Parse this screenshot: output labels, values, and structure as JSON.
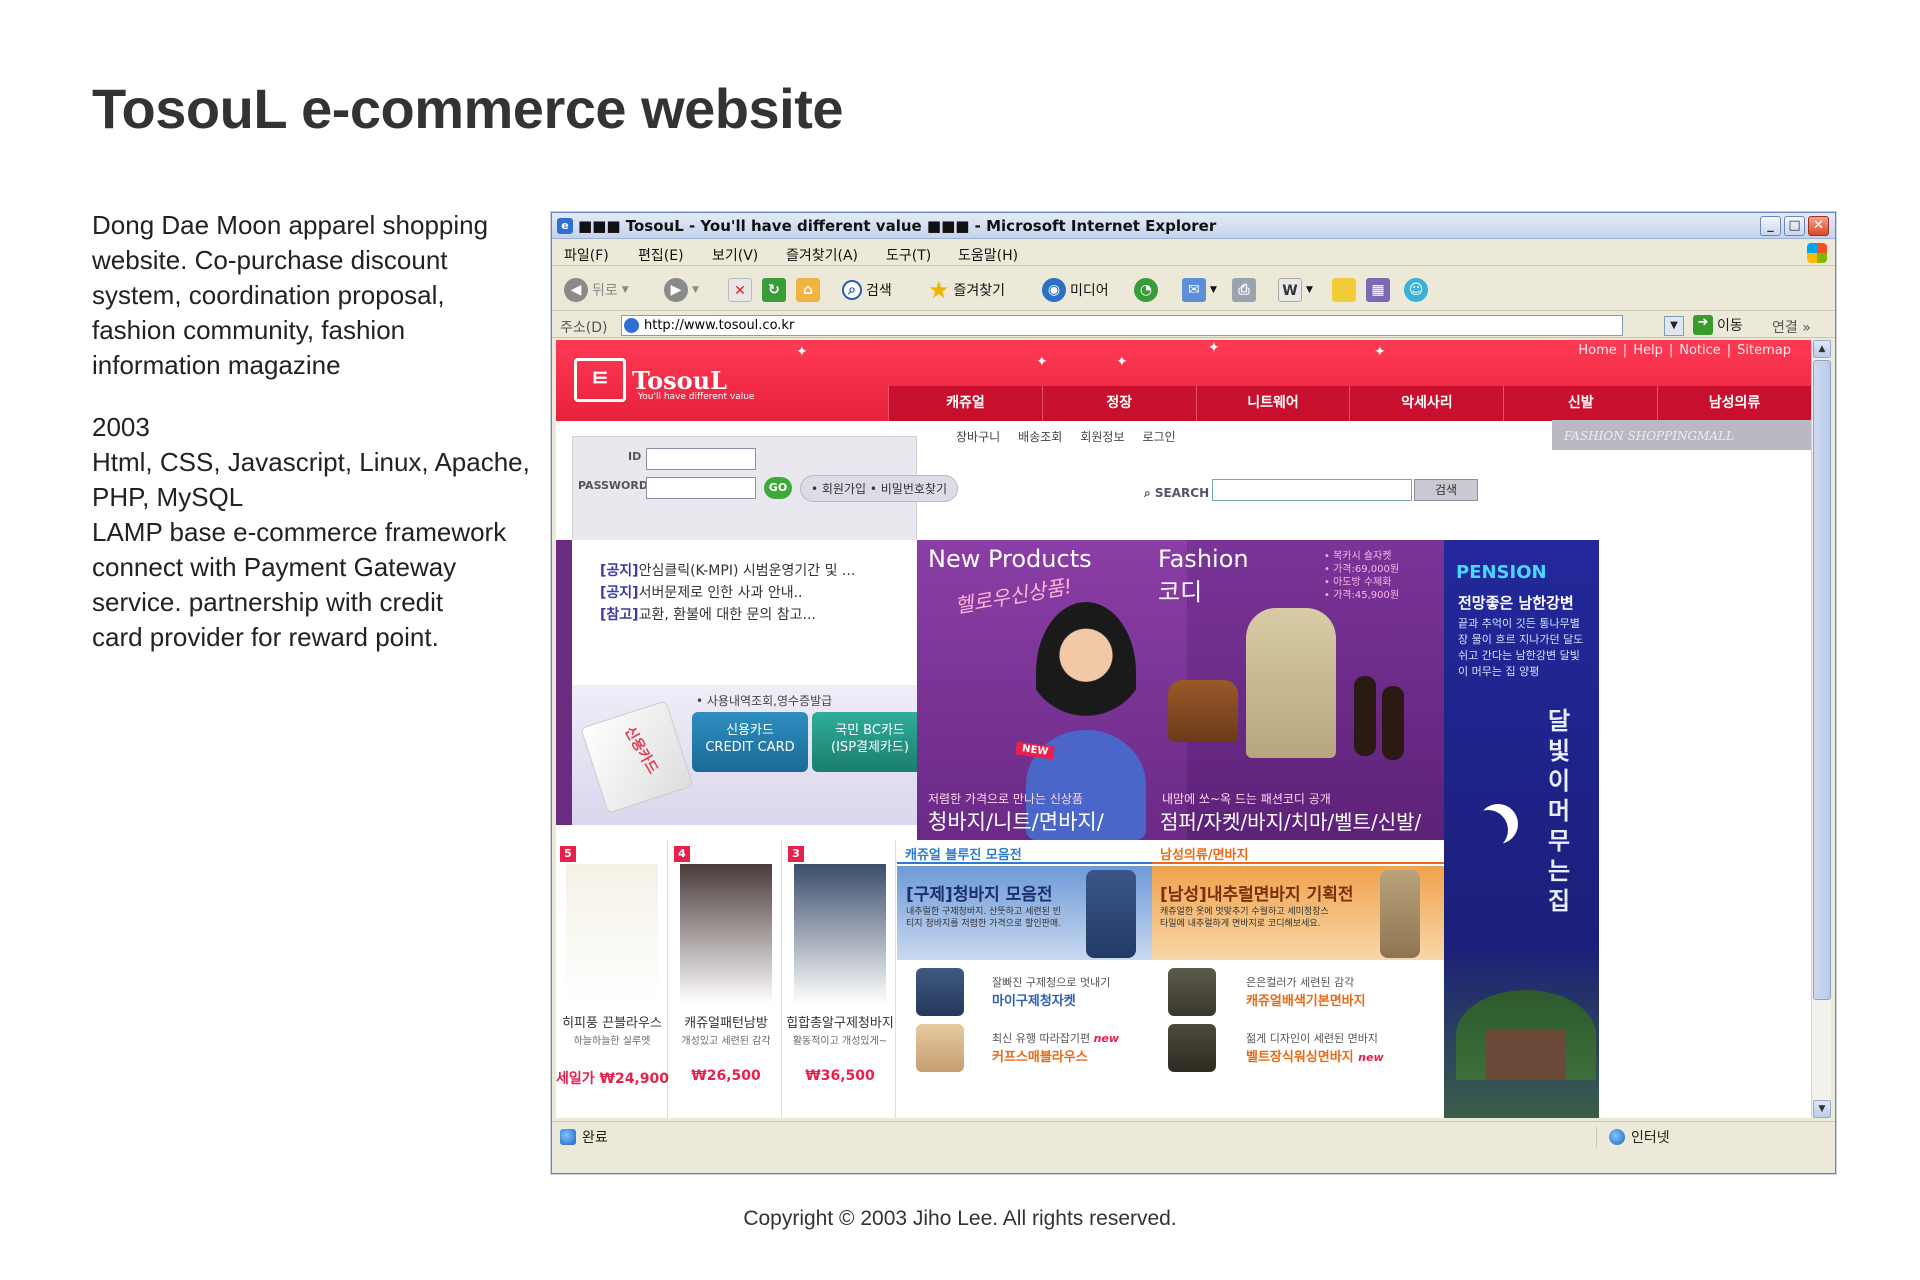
{
  "heading": "TosouL e-commerce website",
  "description": {
    "lines": [
      "Dong Dae Moon apparel shopping",
      "website. Co-purchase discount",
      "system, coordination proposal,",
      "fashion community, fashion",
      "information magazine"
    ],
    "year": "2003",
    "details": [
      "Html, CSS, Javascript, Linux, Apache,",
      "PHP, MySQL",
      "LAMP base e-commerce framework",
      "connect with Payment Gateway",
      "service. partnership with credit",
      "card provider for reward point."
    ]
  },
  "copyright": "Copyright © 2003 Jiho Lee. All rights reserved.",
  "browser": {
    "title": "■■■ TosouL - You'll have different value ■■■ - Microsoft Internet Explorer",
    "menus": [
      "파일(F)",
      "편집(E)",
      "보기(V)",
      "즐겨찾기(A)",
      "도구(T)",
      "도움말(H)"
    ],
    "toolbar": {
      "back": "뒤로",
      "search": "검색",
      "favorites": "즐겨찾기",
      "media": "미디어"
    },
    "address_label": "주소(D)",
    "address": "http://www.tosoul.co.kr",
    "go": "이동",
    "links": "연결",
    "status_left": "완료",
    "status_right": "인터넷"
  },
  "site": {
    "logo": "TosouL",
    "logo_mark": "ㅌ",
    "tagline": "You'll have different value",
    "top_links": [
      "Home",
      "Help",
      "Notice",
      "Sitemap"
    ],
    "categories": [
      "캐쥬얼",
      "정장",
      "니트웨어",
      "악세사리",
      "신발",
      "남성의류"
    ],
    "gnav": [
      "장바구니",
      "배송조회",
      "회원정보",
      "로그인"
    ],
    "fashion_mall": "FASHION SHOPPINGMALL",
    "login": {
      "id_label": "ID",
      "pw_label": "PASSWORD",
      "go": "GO",
      "links": "• 회원가입 • 비밀번호찾기"
    },
    "search": {
      "label": "SEARCH",
      "button": "검색"
    },
    "notices": [
      {
        "tag": "[공지]",
        "text": "안심클릭(K-MPI) 시범운영기간 및 ..."
      },
      {
        "tag": "[공지]",
        "text": "서버문제로 인한 사과 안내.."
      },
      {
        "tag": "[참고]",
        "text": "교환, 환불에 대한 문의 참고..."
      }
    ],
    "card": {
      "label": "• 사용내역조회,영수증발급",
      "image_text": "신용카드",
      "btn1": "신용카드\nCREDIT CARD",
      "btn2": "국민 BC카드\n(ISP결제카드)"
    },
    "new_products": {
      "title": "New Products",
      "script": "헬로우신상품!",
      "new_tag": "NEW",
      "sub": "저렴한 가격으로 만나는 신상품",
      "bottom": "청바지/니트/면바지/"
    },
    "fashion": {
      "title": "Fashion",
      "title2": "코디",
      "info": [
        "• 복카시 숄자켓",
        "• 가격:69,000원",
        "• 아도방 수제화",
        "• 가격:45,900원"
      ],
      "sub": "내맘에 쏘~옥 드는 패션코디 공개",
      "bottom": "점퍼/자켓/바지/치마/벨트/신발/"
    },
    "pension": {
      "title": "PENSION",
      "sub": "전망좋은 남한강변",
      "text": "끝과 추억이 깃든 통나무별장 물이 흐르 지나가던 달도 쉬고 간다는 남한강변 달빛이 머무는 집 양평",
      "big": "달빛이머무는집"
    },
    "products": [
      {
        "rank": "5",
        "name": "히피풍 끈블라우스",
        "desc": "하늘하늘한 실루엣",
        "price": "세일가 ₩24,900",
        "color": "#f4f1e6"
      },
      {
        "rank": "4",
        "name": "캐쥬얼패턴남방",
        "desc": "개성있고 세련된 감각",
        "price": "₩26,500",
        "color": "#4a3a3a"
      },
      {
        "rank": "3",
        "name": "힙합총알구제청바지",
        "desc": "활동적이고 개성있게~",
        "price": "₩36,500",
        "color": "#3c4d6a"
      }
    ],
    "casual_header": "캐쥬얼 블루진 모음전",
    "mens_header": "남성의류/면바지",
    "jeans_banner": {
      "title": "[구제]청바지 모음전",
      "text": "내추럴한 구제청바지. 산뜻하고 세련된 빈티지 청바지를 저렴한 가격으로 할인판매."
    },
    "pants_banner": {
      "title": "[남성]내추럴면바지 기획전",
      "text": "캐쥬얼한 옷에 멋맞추기 수월하고 세미정장스타일에 내추럴하게 면바지로 코디해보세요."
    },
    "small_items": [
      {
        "desc": "잘빠진 구제청으로 멋내기",
        "name": "마이구제청자켓"
      },
      {
        "desc": "최신 유행 따라잡기편",
        "name": "커프스매블라우스",
        "tag": "new"
      },
      {
        "desc": "은은컬러가 세련된 감각",
        "name": "캐쥬얼배색기본면바지"
      },
      {
        "desc": "젊게 디자인이 세련된 면바지",
        "name": "벨트장식워싱면바지",
        "tag": "new"
      }
    ]
  }
}
